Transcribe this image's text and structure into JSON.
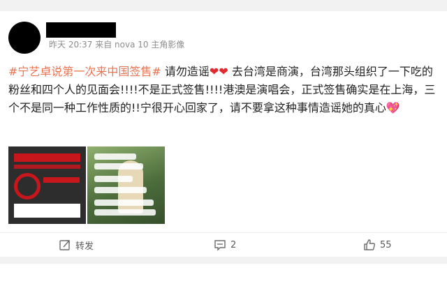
{
  "post": {
    "timestamp": "昨天 20:37",
    "source": "来自 nova 10 主角影像",
    "text_topic": "#宁艺卓说第一次来中国签售#",
    "text_part1": " 请勿造谣",
    "emoji_hearts": "❤❤",
    "text_part2": " 去台湾是商演，台湾那头组织了一下吃的粉丝和四个人的见面会!!!!不是正式签售!!!!港澳是演唱会，正式签售确实是在上海，三个不是同一种工作性质的!!宁很开心回家了，请不要拿这种事情造谣她的真心",
    "emoji_end": "💖"
  },
  "images": [
    {
      "icon": "poster-image"
    },
    {
      "icon": "chat-screenshot-image"
    }
  ],
  "actions": {
    "repost_label": "转发",
    "comment_count": "2",
    "like_count": "55"
  },
  "colors": {
    "topic": "#eb7350",
    "heart": "#e3282f",
    "text": "#222222",
    "meta": "#8c8c8c"
  }
}
